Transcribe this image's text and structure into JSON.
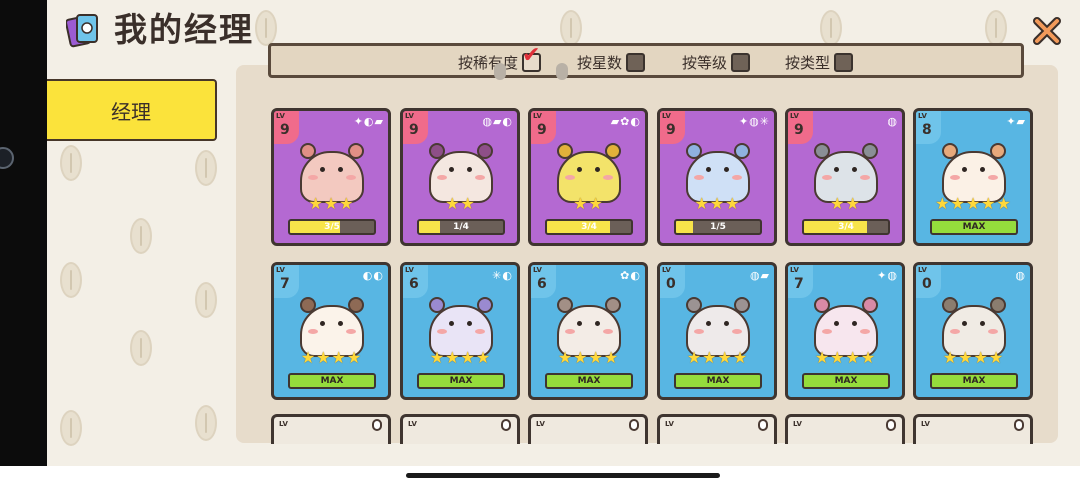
{
  "header": {
    "title": "我的经理"
  },
  "sidebar": {
    "active_tab": "经理"
  },
  "filters": [
    {
      "label": "按稀有度",
      "checked": true
    },
    {
      "label": "按星数",
      "checked": false
    },
    {
      "label": "按等级",
      "checked": false
    },
    {
      "label": "按类型",
      "checked": false
    }
  ],
  "overlay_pills": {
    "red": "",
    "green": ""
  },
  "managers": [
    {
      "rarity": "purple",
      "lv_tag": "LV",
      "level": "9",
      "stars": 3,
      "progress_text": "3/5",
      "progress": 0.6,
      "skill_icons": "✦◐▰",
      "fur": "#f3c9c0",
      "ear": "#e18f86"
    },
    {
      "rarity": "purple",
      "lv_tag": "LV",
      "level": "9",
      "stars": 2,
      "progress_text": "1/4",
      "progress": 0.25,
      "skill_icons": "◍▰◐",
      "fur": "#f4e7e0",
      "ear": "#8e4f88"
    },
    {
      "rarity": "purple",
      "lv_tag": "LV",
      "level": "9",
      "stars": 2,
      "progress_text": "3/4",
      "progress": 0.75,
      "skill_icons": "▰✿◐",
      "fur": "#f3e36a",
      "ear": "#e2b13a"
    },
    {
      "rarity": "purple",
      "lv_tag": "LV",
      "level": "9",
      "stars": 3,
      "progress_text": "1/5",
      "progress": 0.2,
      "skill_icons": "✦◍✳",
      "fur": "#cfe0f6",
      "ear": "#8fb2e0"
    },
    {
      "rarity": "purple",
      "lv_tag": "LV",
      "level": "9",
      "stars": 2,
      "progress_text": "3/4",
      "progress": 0.75,
      "skill_icons": "◍",
      "fur": "#dde3e8",
      "ear": "#8a8f96"
    },
    {
      "rarity": "blue",
      "lv_tag": "LV",
      "level": "8",
      "stars": 5,
      "progress_text": "MAX",
      "progress": 1.0,
      "skill_icons": "✦▰",
      "fur": "#fbf1e6",
      "ear": "#e7a97b"
    },
    {
      "rarity": "blue",
      "lv_tag": "LV",
      "level": "7",
      "stars": 4,
      "progress_text": "MAX",
      "progress": 1.0,
      "skill_icons": "◐◐",
      "fur": "#fbf3ea",
      "ear": "#8e6a55"
    },
    {
      "rarity": "blue",
      "lv_tag": "LV",
      "level": "6",
      "stars": 4,
      "progress_text": "MAX",
      "progress": 1.0,
      "skill_icons": "✳◐",
      "fur": "#e9e4f6",
      "ear": "#9a8ad0"
    },
    {
      "rarity": "blue",
      "lv_tag": "LV",
      "level": "6",
      "stars": 4,
      "progress_text": "MAX",
      "progress": 1.0,
      "skill_icons": "✿◐",
      "fur": "#f3ece6",
      "ear": "#a28f86"
    },
    {
      "rarity": "blue",
      "lv_tag": "LV",
      "level": "0",
      "stars": 4,
      "progress_text": "MAX",
      "progress": 1.0,
      "skill_icons": "◍▰",
      "fur": "#eeeaea",
      "ear": "#9b9393"
    },
    {
      "rarity": "blue",
      "lv_tag": "LV",
      "level": "7",
      "stars": 4,
      "progress_text": "MAX",
      "progress": 1.0,
      "skill_icons": "✦◍",
      "fur": "#f7e6ee",
      "ear": "#d98aa6"
    },
    {
      "rarity": "blue",
      "lv_tag": "LV",
      "level": "0",
      "stars": 4,
      "progress_text": "MAX",
      "progress": 1.0,
      "skill_icons": "◍",
      "fur": "#f0ebe4",
      "ear": "#8b7d6f"
    }
  ],
  "stub_tag": "LV",
  "icons": {
    "title": "card-deck-icon",
    "close": "close-x-icon",
    "check": "checkmark-icon"
  },
  "colors": {
    "accent_yellow": "#fbe33b",
    "purple_card": "#b469d2",
    "blue_card": "#58b6e3",
    "max_green": "#95dc3c",
    "progress_yellow": "#f7e44a"
  }
}
